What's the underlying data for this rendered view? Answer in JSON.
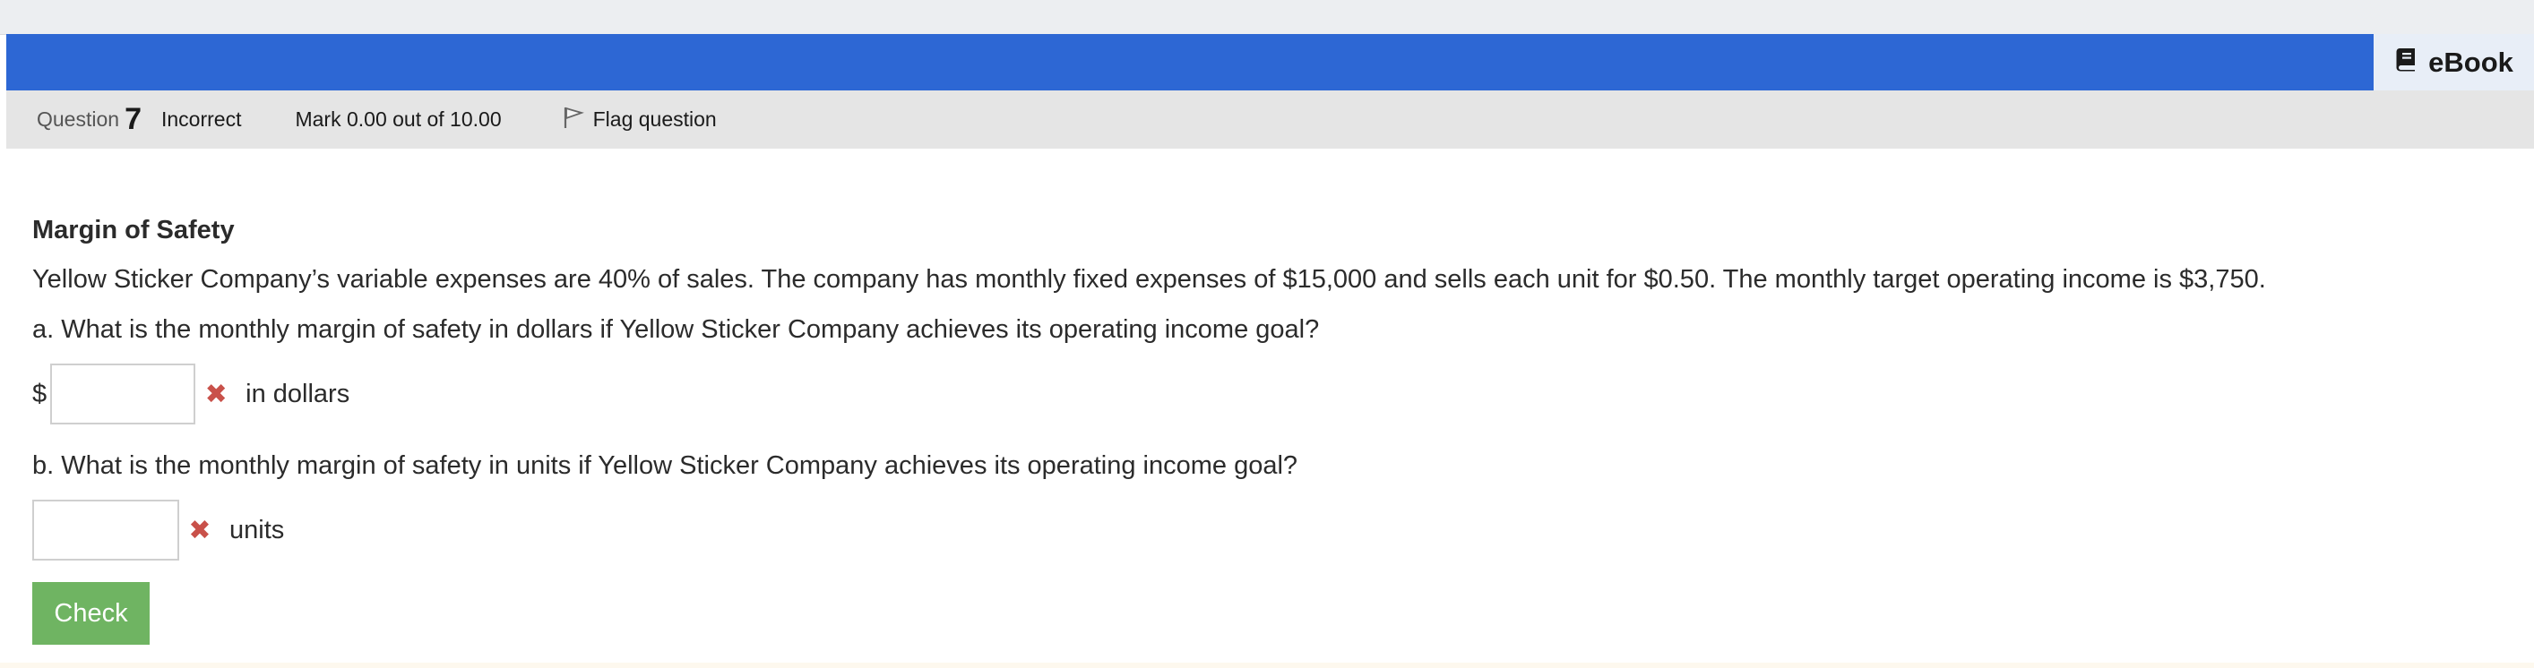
{
  "header": {
    "ebook_label": "eBook",
    "ebook_icon": "book-icon",
    "accent_color": "#2d67d4"
  },
  "question_info": {
    "label": "Question",
    "number": "7",
    "state": "Incorrect",
    "mark": "Mark 0.00 out of 10.00",
    "flag_label": "Flag question",
    "flag_icon": "flag-icon"
  },
  "question": {
    "title": "Margin of Safety",
    "text": "Yellow Sticker Company’s variable expenses are 40% of sales. The company has monthly fixed expenses of $15,000 and sells each unit for $0.50. The monthly target operating income is $3,750.",
    "part_a": {
      "prompt": "a.  What is the monthly margin of safety in dollars if Yellow Sticker Company achieves its operating income goal?",
      "prefix": "$",
      "value": "",
      "status_icon": "incorrect-x-icon",
      "unit": "in dollars"
    },
    "part_b": {
      "prompt": "b.  What is the monthly margin of safety in units if Yellow Sticker Company achieves its operating income goal?",
      "value": "",
      "status_icon": "incorrect-x-icon",
      "unit": "units"
    },
    "check_label": "Check",
    "check_color": "#6fb462",
    "incorrect_color": "#c9514a"
  }
}
